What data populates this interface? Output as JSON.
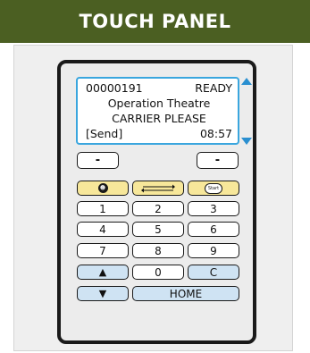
{
  "header": {
    "title": "TOUCH PANEL"
  },
  "screen": {
    "line1_left": "00000191",
    "line1_right": "READY",
    "line2": "Operation Theatre",
    "line3": "CARRIER PLEASE",
    "line4_left": "[Send]",
    "line4_right": "08:57"
  },
  "softkeys": {
    "left": "-",
    "right": "-"
  },
  "function_keys": {
    "left_icon": "user-icon",
    "middle_icon": "swap-arrows-icon",
    "right_icon": "start-icon",
    "right_icon_text": "Start"
  },
  "keypad": {
    "k1": "1",
    "k2": "2",
    "k3": "3",
    "k4": "4",
    "k5": "5",
    "k6": "6",
    "k7": "7",
    "k8": "8",
    "k9": "9",
    "k0": "0",
    "clear": "C",
    "home": "HOME",
    "up": "▲",
    "down": "▼"
  },
  "colors": {
    "header_bg": "#4b5f22",
    "screen_border": "#3aa6de",
    "yellow_key": "#f7e79a",
    "blue_key": "#cfe3f3"
  }
}
